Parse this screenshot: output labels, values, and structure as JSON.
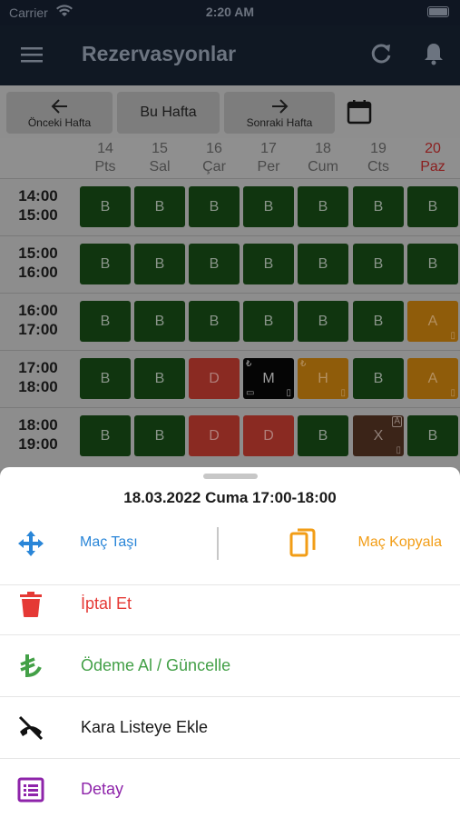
{
  "status_bar": {
    "carrier": "Carrier",
    "time": "2:20 AM"
  },
  "header": {
    "title": "Rezervasyonlar"
  },
  "week_nav": {
    "prev": "Önceki Hafta",
    "current": "Bu Hafta",
    "next": "Sonraki Hafta"
  },
  "days": [
    {
      "num": "14",
      "name": "Pts"
    },
    {
      "num": "15",
      "name": "Sal"
    },
    {
      "num": "16",
      "name": "Çar"
    },
    {
      "num": "17",
      "name": "Per"
    },
    {
      "num": "18",
      "name": "Cum"
    },
    {
      "num": "19",
      "name": "Cts"
    },
    {
      "num": "20",
      "name": "Paz"
    }
  ],
  "slots": [
    {
      "start": "14:00",
      "end": "15:00",
      "cells": [
        {
          "t": "B",
          "c": "green"
        },
        {
          "t": "B",
          "c": "green"
        },
        {
          "t": "B",
          "c": "green"
        },
        {
          "t": "B",
          "c": "green"
        },
        {
          "t": "B",
          "c": "green"
        },
        {
          "t": "B",
          "c": "green"
        },
        {
          "t": "B",
          "c": "green"
        }
      ]
    },
    {
      "start": "15:00",
      "end": "16:00",
      "cells": [
        {
          "t": "B",
          "c": "green"
        },
        {
          "t": "B",
          "c": "green"
        },
        {
          "t": "B",
          "c": "green"
        },
        {
          "t": "B",
          "c": "green"
        },
        {
          "t": "B",
          "c": "green"
        },
        {
          "t": "B",
          "c": "green"
        },
        {
          "t": "B",
          "c": "green"
        }
      ]
    },
    {
      "start": "16:00",
      "end": "17:00",
      "cells": [
        {
          "t": "B",
          "c": "green"
        },
        {
          "t": "B",
          "c": "green"
        },
        {
          "t": "B",
          "c": "green"
        },
        {
          "t": "B",
          "c": "green"
        },
        {
          "t": "B",
          "c": "green"
        },
        {
          "t": "B",
          "c": "green"
        },
        {
          "t": "A",
          "c": "orange",
          "br": "▯"
        }
      ]
    },
    {
      "start": "17:00",
      "end": "18:00",
      "cells": [
        {
          "t": "B",
          "c": "green"
        },
        {
          "t": "B",
          "c": "green"
        },
        {
          "t": "D",
          "c": "red"
        },
        {
          "t": "M",
          "c": "black",
          "tl": "₺",
          "bl": "▭",
          "br": "▯"
        },
        {
          "t": "H",
          "c": "orange",
          "tl": "₺",
          "br": "▯"
        },
        {
          "t": "B",
          "c": "green"
        },
        {
          "t": "A",
          "c": "orange",
          "br": "▯"
        }
      ]
    },
    {
      "start": "18:00",
      "end": "19:00",
      "cells": [
        {
          "t": "B",
          "c": "green"
        },
        {
          "t": "B",
          "c": "green"
        },
        {
          "t": "D",
          "c": "red"
        },
        {
          "t": "D",
          "c": "red"
        },
        {
          "t": "B",
          "c": "green"
        },
        {
          "t": "X",
          "c": "brown",
          "tr": "A",
          "br": "▯"
        },
        {
          "t": "B",
          "c": "green"
        }
      ]
    }
  ],
  "sheet": {
    "title": "18.03.2022 Cuma 17:00-18:00",
    "move": "Maç Taşı",
    "copy": "Maç Kopyala",
    "cancel": "İptal Et",
    "payment": "Ödeme Al / Güncelle",
    "blacklist": "Kara Listeye Ekle",
    "detail": "Detay"
  },
  "colors": {
    "move": "#2a86d8",
    "copy": "#f29d16",
    "cancel": "#e53935",
    "payment": "#43a047",
    "blacklist": "#1a1a1a",
    "detail": "#8e24aa"
  }
}
